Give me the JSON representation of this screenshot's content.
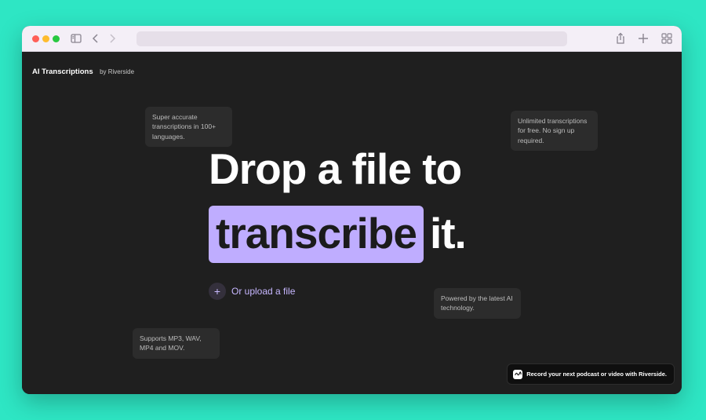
{
  "brand": {
    "title": "AI Transcriptions",
    "by": "by Riverside"
  },
  "hero": {
    "line1": "Drop a file to",
    "highlight": "transcribe",
    "after": "it.",
    "highlight_color": "#bfadff"
  },
  "upload": {
    "icon": "plus-icon",
    "label": "Or upload a file"
  },
  "tips": {
    "accuracy": "Super accurate transcriptions in 100+ languages.",
    "unlimited": "Unlimited transcriptions for free. No sign up required.",
    "ai": "Powered by the latest AI technology.",
    "formats": "Supports MP3, WAV, MP4 and MOV."
  },
  "promo": {
    "icon": "riverside-wave-icon",
    "text": "Record your next podcast or video with Riverside."
  },
  "colors": {
    "background": "#2ee6c4",
    "page": "#1f1f1f",
    "accent": "#bfadff"
  }
}
